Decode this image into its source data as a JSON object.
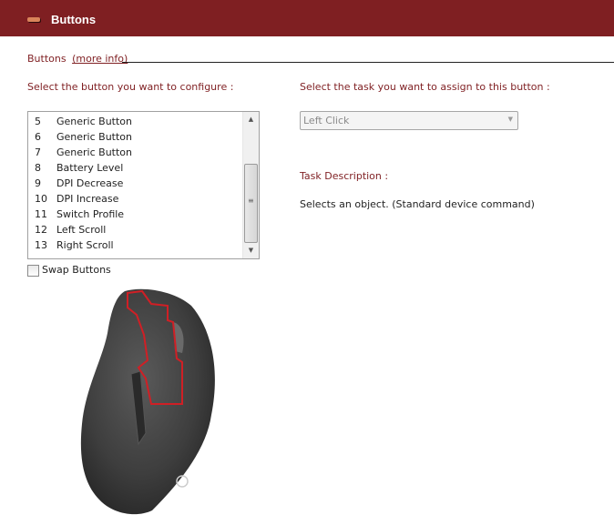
{
  "header": {
    "title": "Buttons",
    "icon": "buttons-icon"
  },
  "section": {
    "title": "Buttons",
    "more_info": "(more info)"
  },
  "button_select": {
    "label": "Select the button you want to configure :",
    "items": [
      {
        "num": "5",
        "name": "Generic Button"
      },
      {
        "num": "6",
        "name": "Generic Button"
      },
      {
        "num": "7",
        "name": "Generic Button"
      },
      {
        "num": "8",
        "name": "Battery Level"
      },
      {
        "num": "9",
        "name": "DPI Decrease"
      },
      {
        "num": "10",
        "name": "DPI Increase"
      },
      {
        "num": "11",
        "name": "Switch Profile"
      },
      {
        "num": "12",
        "name": "Left Scroll"
      },
      {
        "num": "13",
        "name": "Right Scroll"
      }
    ]
  },
  "swap": {
    "label": "Swap Buttons",
    "checked": false
  },
  "task_select": {
    "label": "Select the task you want to assign to this button :",
    "value": "Left Click"
  },
  "task_description": {
    "label": "Task Description :",
    "text": "Selects an object. (Standard device command)"
  },
  "colors": {
    "header_bg": "#7f1f22",
    "accent_text": "#7f1f22",
    "highlight": "#d01f25"
  }
}
